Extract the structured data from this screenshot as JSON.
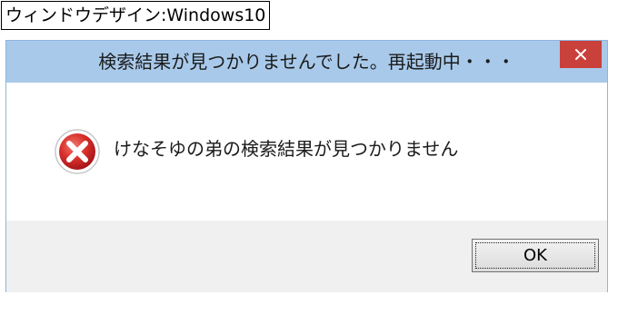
{
  "caption": "ウィンドウデザイン:Windows10",
  "dialog": {
    "title": "検索結果が見つかりませんでした。再起動中・・・",
    "close_symbol": "×",
    "message": "けなそゆの弟の検索結果が見つかりません",
    "icon": "error-icon",
    "ok_label": "OK"
  },
  "colors": {
    "titlebar": "#a8c9ea",
    "close_button": "#c9413a",
    "error_red": "#d9302b",
    "button_bar": "#f0f0f0"
  }
}
